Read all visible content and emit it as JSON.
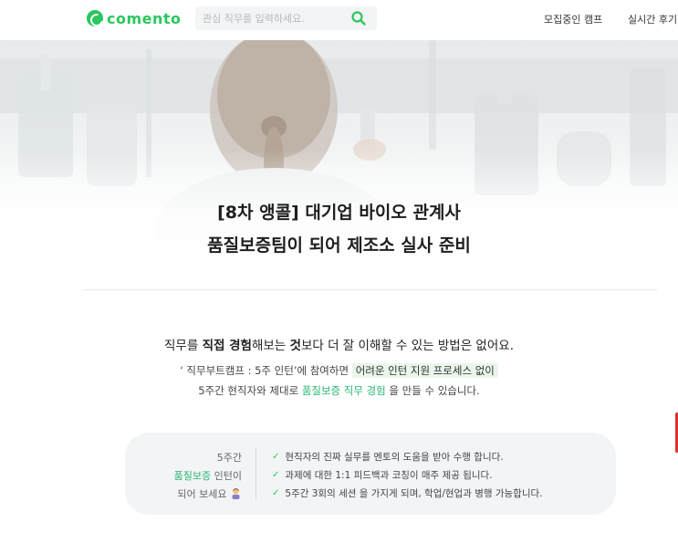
{
  "header": {
    "logo_text": "comento",
    "search_placeholder": "관심 직무를 입력하세요.",
    "nav": {
      "camp": "모집중인 캠프",
      "review": "실시간 후기"
    }
  },
  "hero": {
    "title_line1": "[8차 앵콜] 대기업 바이오 관계사",
    "title_line2": "품질보증팀이 되어 제조소 실사 준비"
  },
  "intro": {
    "head_1": "직무를 ",
    "head_bold_1": "직접 경험",
    "head_2": "해보는 ",
    "head_bold_2": "것",
    "head_3": "보다 더 잘 이해할 수 있는 방법은 없어요.",
    "line1_a": "‘ 직무부트캠프 : 5주 인턴’에 참여하면 ",
    "line1_hl": "어려운 인턴 지원 프로세스 없이",
    "line2_a": "5주간 현직자와 제대로 ",
    "line2_green": "품질보증 직무 경험",
    "line2_b": " 을 만들 수 있습니다."
  },
  "benefits": {
    "left_1": "5주간",
    "left_2_green": "품질보증",
    "left_2": " 인턴이",
    "left_3": "되어 보세요",
    "items": [
      "현직자의 진짜 실무를 멘토의 도움을 받아 수행 합니다.",
      "과제에 대한 1:1 피드백과 코칭이 매주 제공 됩니다.",
      "5주간 3회의 세션 을 가지게 되며, 학업/현업과 병행 가능합니다."
    ]
  },
  "colors": {
    "brand": "#2bc65f",
    "accent_text": "#2bb673",
    "highlight_bg": "#e9f6ec"
  }
}
